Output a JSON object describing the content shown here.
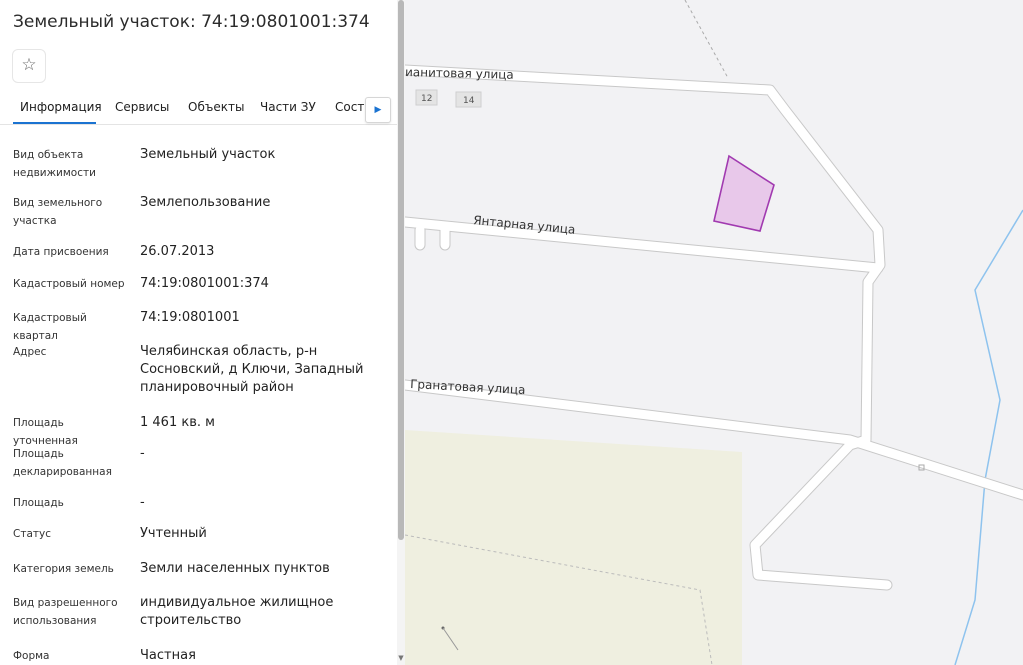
{
  "title": "Земельный участок: 74:19:0801001:374",
  "tabs": [
    "Информация",
    "Сервисы",
    "Объекты",
    "Части ЗУ",
    "Соста"
  ],
  "fields": [
    {
      "label": "Вид объекта недвижимости",
      "value": "Земельный участок"
    },
    {
      "label": "Вид земельного участка",
      "value": "Землепользование"
    },
    {
      "label": "Дата присвоения",
      "value": "26.07.2013"
    },
    {
      "label": "Кадастровый номер",
      "value": "74:19:0801001:374"
    },
    {
      "label": "Кадастровый квартал",
      "value": "74:19:0801001"
    },
    {
      "label": "Адрес",
      "value": "Челябинская область, р-н Сосновский, д Ключи, Западный планировочный район"
    },
    {
      "label": "Площадь уточненная",
      "value": "1 461 кв. м"
    },
    {
      "label": "Площадь декларированная",
      "value": "-"
    },
    {
      "label": "Площадь",
      "value": "-"
    },
    {
      "label": "Статус",
      "value": "Учтенный"
    },
    {
      "label": "Категория земель",
      "value": "Земли населенных пунктов"
    },
    {
      "label": "Вид разрешенного использования",
      "value": "индивидуальное жилищное строительство"
    },
    {
      "label": "Форма собственности",
      "value": "Частная"
    }
  ],
  "map": {
    "streets": [
      "ианитовая улица",
      "Янтарная улица",
      "Гранатовая улица"
    ],
    "house_numbers": [
      "12",
      "14"
    ],
    "parcel_color": "#a13ab0",
    "parcel_fill": "#e8c8ea"
  },
  "icons": {
    "favorite": "star-icon",
    "tabs_next": "chevron-right-icon",
    "scroll_down": "chevron-down-icon"
  }
}
